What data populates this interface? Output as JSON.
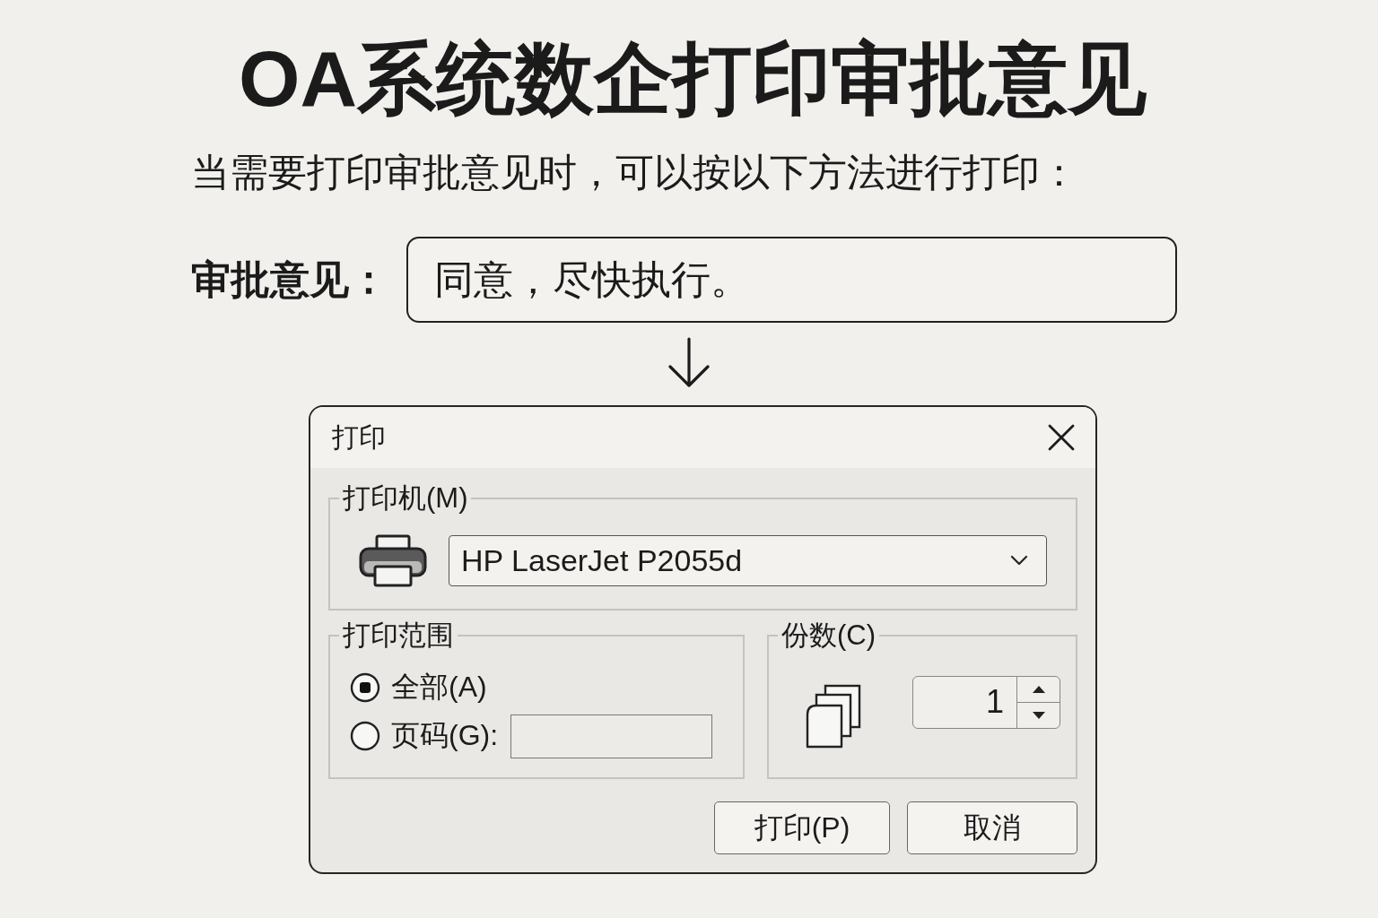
{
  "title": "OA系统数企打印审批意见",
  "intro": "当需要打印审批意见时，可以按以下方法进行打印：",
  "opinion": {
    "label": "审批意见：",
    "value": "同意，尽快执行。"
  },
  "dialog": {
    "title": "打印",
    "printer_group": {
      "legend": "打印机(M)",
      "printer": "HP LaserJet P2055d"
    },
    "range_group": {
      "legend": "打印范围",
      "options": [
        {
          "kind": "all",
          "label": "全部(A)",
          "selected": true
        },
        {
          "kind": "pages",
          "label": "页码(G):",
          "selected": false
        }
      ]
    },
    "copies_group": {
      "legend": "份数(C)",
      "value": "1"
    },
    "buttons": [
      {
        "label": "打印(P)"
      },
      {
        "label": "取消"
      }
    ]
  }
}
